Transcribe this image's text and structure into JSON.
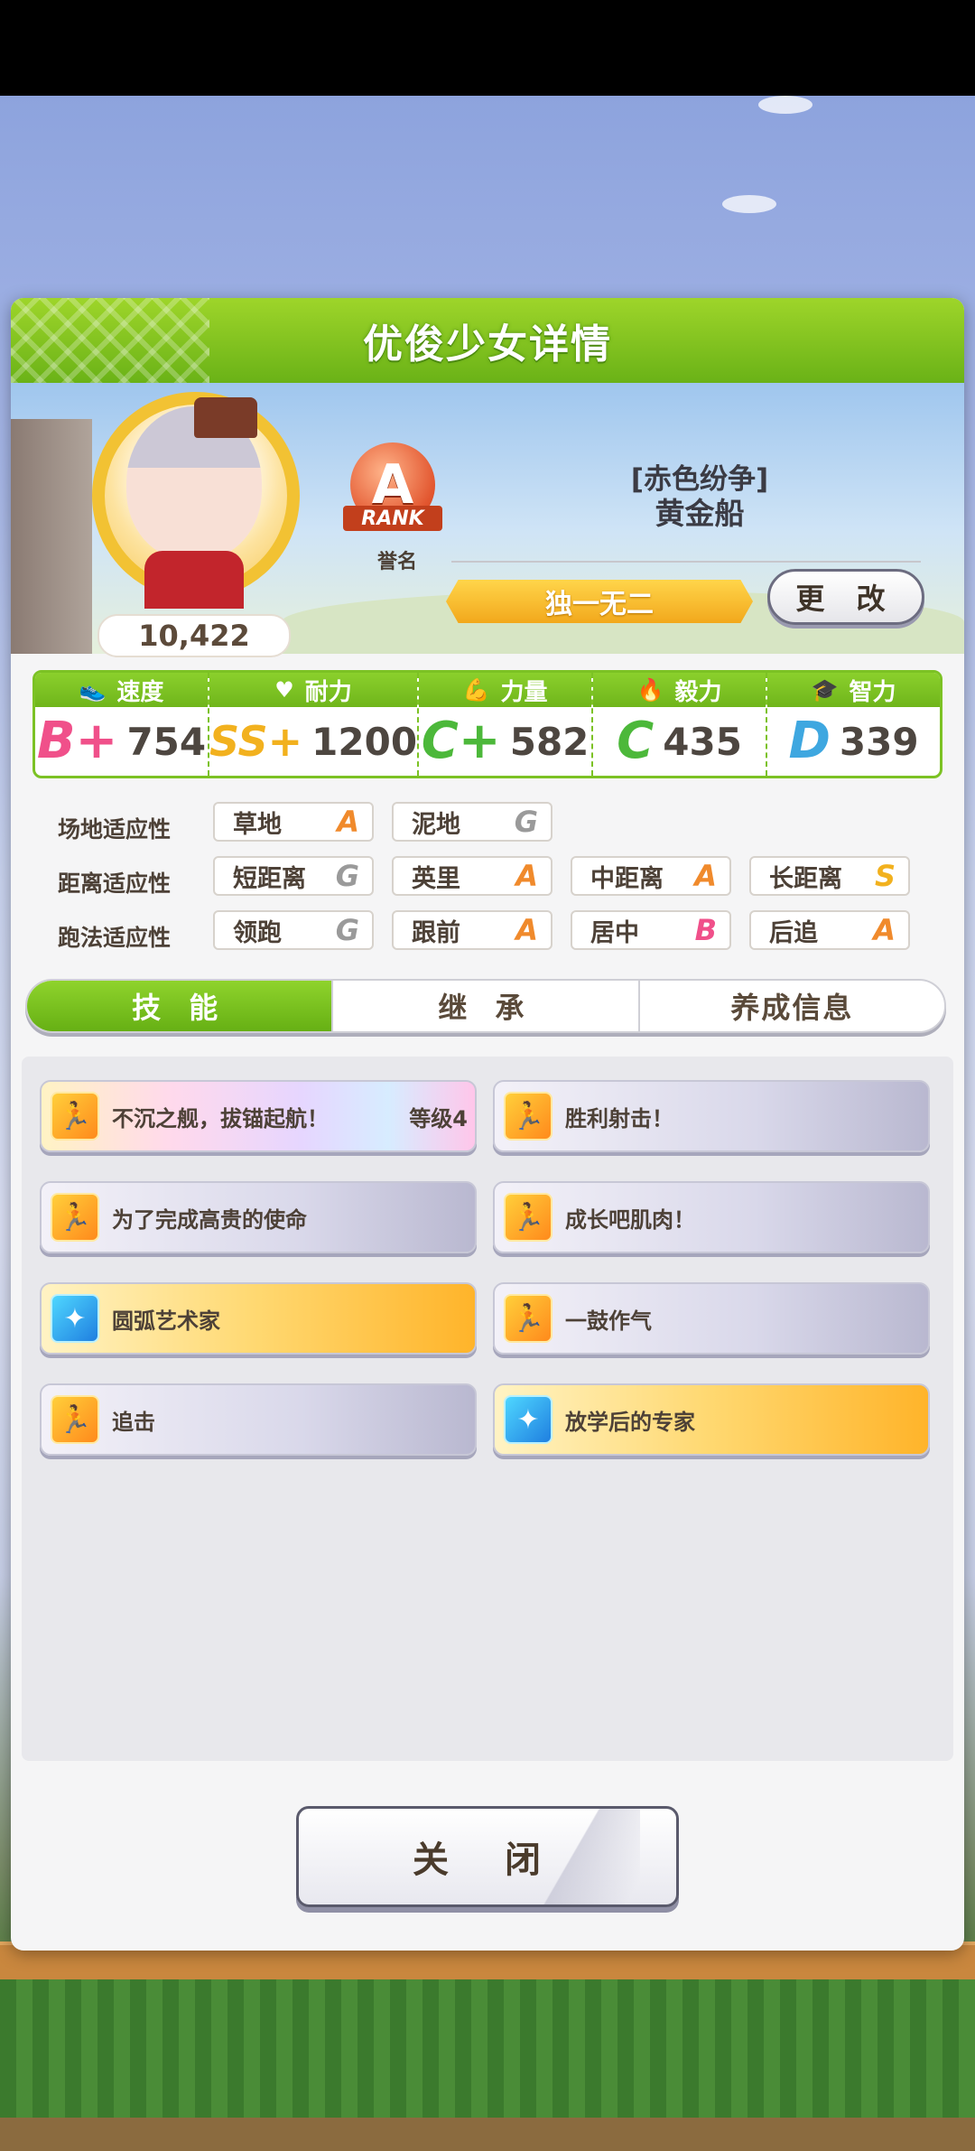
{
  "panel": {
    "title": "优俊少女详情"
  },
  "profile": {
    "fans": "10,422",
    "rank": {
      "letter": "A",
      "ribbon": "RANK",
      "label": "誉名"
    },
    "epithet": "[赤色纷争]",
    "name": "黄金船",
    "title": "独一无二",
    "change_label": "更 改"
  },
  "stats": [
    {
      "label": "速度",
      "icon": "shoe-icon",
      "grade": "B+",
      "grade_color": "#f0508a",
      "value": "754"
    },
    {
      "label": "耐力",
      "icon": "heart-icon",
      "grade": "SS+",
      "grade_color": "#f2b11e",
      "value": "1200"
    },
    {
      "label": "力量",
      "icon": "muscle-icon",
      "grade": "C+",
      "grade_color": "#4cb83a",
      "value": "582"
    },
    {
      "label": "毅力",
      "icon": "flame-icon",
      "grade": "C",
      "grade_color": "#4cb83a",
      "value": "435"
    },
    {
      "label": "智力",
      "icon": "graduation-cap-icon",
      "grade": "D",
      "grade_color": "#3ea7e0",
      "value": "339"
    }
  ],
  "aptitude": {
    "track": {
      "label": "场地适应性",
      "items": [
        {
          "name": "草地",
          "grade": "A"
        },
        {
          "name": "泥地",
          "grade": "G"
        }
      ]
    },
    "distance": {
      "label": "距离适应性",
      "items": [
        {
          "name": "短距离",
          "grade": "G"
        },
        {
          "name": "英里",
          "grade": "A"
        },
        {
          "name": "中距离",
          "grade": "A"
        },
        {
          "name": "长距离",
          "grade": "S"
        }
      ]
    },
    "style": {
      "label": "跑法适应性",
      "items": [
        {
          "name": "领跑",
          "grade": "G"
        },
        {
          "name": "跟前",
          "grade": "A"
        },
        {
          "name": "居中",
          "grade": "B"
        },
        {
          "name": "后追",
          "grade": "A"
        }
      ]
    },
    "grade_colors": {
      "A": "#f08a2c",
      "B": "#f0508a",
      "G": "#9a9a9a",
      "S": "#f2b11e"
    }
  },
  "tabs": [
    {
      "label": "技 能",
      "active": true
    },
    {
      "label": "继 承",
      "active": false
    },
    {
      "label": "养成信息",
      "active": false
    }
  ],
  "skills": [
    {
      "name": "不沉之舰，拔锚起航！",
      "level": "等级4",
      "style": "rainbow",
      "icon": "speed-skill-icon"
    },
    {
      "name": "胜利射击！",
      "level": "",
      "style": "normal",
      "icon": "speed-skill-icon"
    },
    {
      "name": "为了完成高贵的使命",
      "level": "",
      "style": "normal",
      "icon": "speed-skill-icon"
    },
    {
      "name": "成长吧肌肉！",
      "level": "",
      "style": "normal",
      "icon": "speed-skill-icon"
    },
    {
      "name": "圆弧艺术家",
      "level": "",
      "style": "gold",
      "icon": "recovery-skill-icon"
    },
    {
      "name": "一鼓作气",
      "level": "",
      "style": "normal",
      "icon": "speed-skill-icon"
    },
    {
      "name": "追击",
      "level": "",
      "style": "normal",
      "icon": "speed-skill-icon"
    },
    {
      "name": "放学后的专家",
      "level": "",
      "style": "gold",
      "icon": "recovery-skill-icon"
    }
  ],
  "close_label": "关 闭"
}
